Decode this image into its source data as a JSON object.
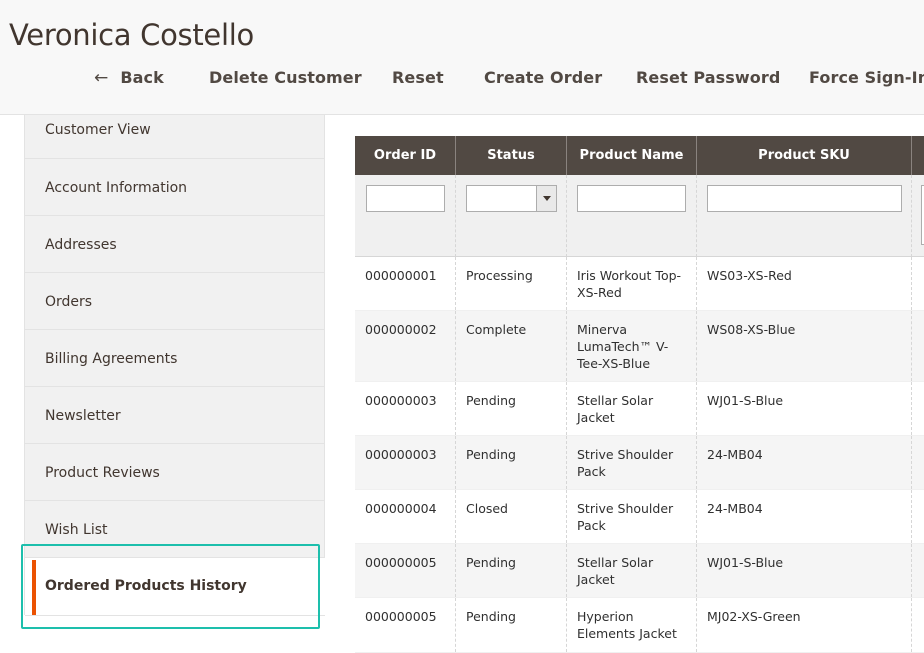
{
  "header": {
    "title": "Veronica Costello",
    "actions": {
      "back": "Back",
      "back_icon": "arrow-left-icon",
      "delete": "Delete Customer",
      "reset": "Reset",
      "create_order": "Create Order",
      "reset_password": "Reset Password",
      "force_sign_in": "Force Sign-In"
    }
  },
  "sidebar": {
    "items": [
      {
        "label": "Customer View"
      },
      {
        "label": "Account Information"
      },
      {
        "label": "Addresses"
      },
      {
        "label": "Orders"
      },
      {
        "label": "Billing Agreements"
      },
      {
        "label": "Newsletter"
      },
      {
        "label": "Product Reviews"
      },
      {
        "label": "Wish List"
      },
      {
        "label": "Ordered Products History",
        "active": true
      }
    ]
  },
  "grid": {
    "columns": [
      "Order ID",
      "Status",
      "Product Name",
      "Product SKU"
    ],
    "rows": [
      {
        "order_id": "000000001",
        "status": "Processing",
        "product_name": "Iris Workout Top-XS-Red",
        "sku": "WS03-XS-Red"
      },
      {
        "order_id": "000000002",
        "status": "Complete",
        "product_name": "Minerva LumaTech™ V-Tee-XS-Blue",
        "sku": "WS08-XS-Blue"
      },
      {
        "order_id": "000000003",
        "status": "Pending",
        "product_name": "Stellar Solar Jacket",
        "sku": "WJ01-S-Blue"
      },
      {
        "order_id": "000000003",
        "status": "Pending",
        "product_name": "Strive Shoulder Pack",
        "sku": "24-MB04"
      },
      {
        "order_id": "000000004",
        "status": "Closed",
        "product_name": "Strive Shoulder Pack",
        "sku": "24-MB04"
      },
      {
        "order_id": "000000005",
        "status": "Pending",
        "product_name": "Stellar Solar Jacket",
        "sku": "WJ01-S-Blue"
      },
      {
        "order_id": "000000005",
        "status": "Pending",
        "product_name": "Hyperion Elements Jacket",
        "sku": "MJ02-XS-Green"
      }
    ]
  },
  "colors": {
    "header_bg": "#514943",
    "active_accent": "#eb5202",
    "focus_ring": "#1dbfac"
  }
}
